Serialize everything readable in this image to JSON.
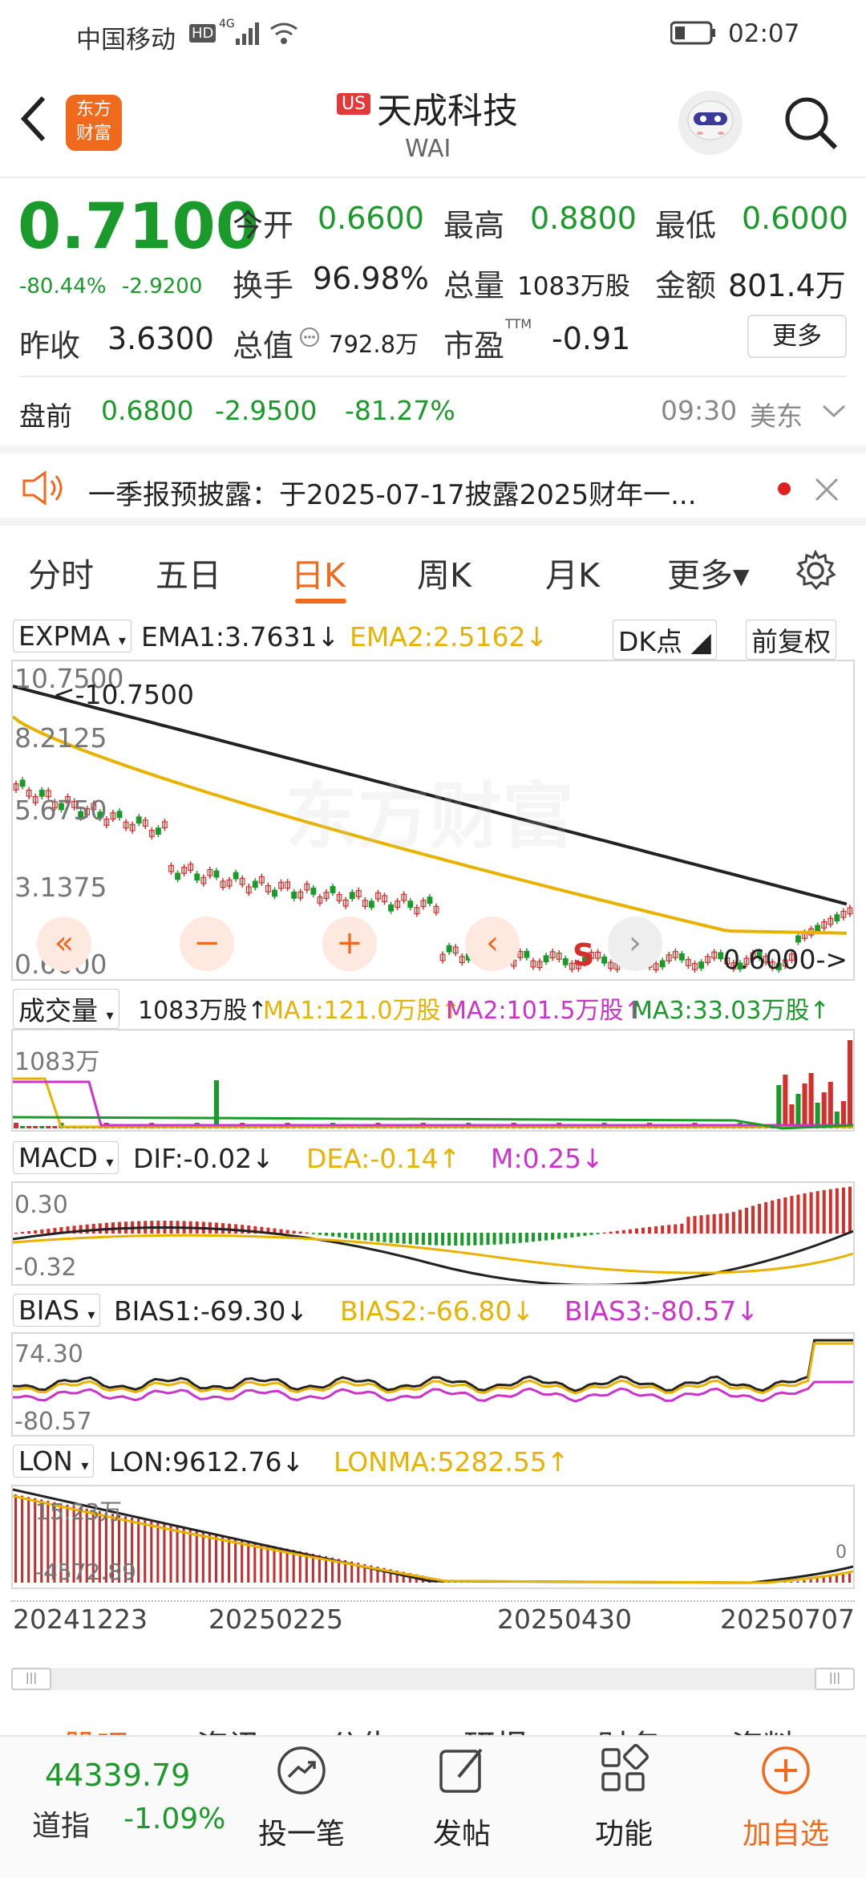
{
  "status_bar": {
    "carrier": "中国移动",
    "hd": "HD",
    "net": "4G",
    "time": "02:07"
  },
  "header": {
    "app_logo": "东方\n财富",
    "market_badge": "US",
    "stock_name": "天成科技",
    "ticker": "WAI"
  },
  "quote": {
    "price": "0.7100",
    "change_pct": "-80.44%",
    "change": "-2.9200",
    "open_label": "今开",
    "open": "0.6600",
    "high_label": "最高",
    "high": "0.8800",
    "low_label": "最低",
    "low": "0.6000",
    "turnover_label": "换手",
    "turnover": "96.98%",
    "volume_label": "总量",
    "volume": "1083万股",
    "amount_label": "金额",
    "amount": "801.4万",
    "prev_close_label": "昨收",
    "prev_close": "3.6300",
    "mktcap_label": "总值",
    "mktcap": "792.8万",
    "pe_label": "市盈",
    "pe_sup": "TTM",
    "pe": "-0.91",
    "more_label": "更多"
  },
  "premarket": {
    "label": "盘前",
    "price": "0.6800",
    "change": "-2.9500",
    "pct": "-81.27%",
    "time": "09:30",
    "zone": "美东"
  },
  "notice": {
    "text": "一季报预披露：于2025-07-17披露2025财年一..."
  },
  "tabs": [
    "分时",
    "五日",
    "日K",
    "周K",
    "月K",
    "更多▾"
  ],
  "active_tab": "日K",
  "ema_row": {
    "name": "EXPMA",
    "ema1": "EMA1:3.7631↓",
    "ema2": "EMA2:2.5162↓",
    "dk": "DK点",
    "adj": "前复权"
  },
  "kline": {
    "y_labels": [
      "10.7500",
      "8.2125",
      "5.6750",
      "3.1375",
      "0.6000"
    ],
    "max_note": "<-10.7500",
    "min_note": "0.6000->",
    "signal": "S",
    "watermark": "东方财富"
  },
  "volume_row": {
    "name": "成交量",
    "vol": "1083万股↑",
    "ma1": "MA1:121.0万股↑",
    "ma2": "MA2:101.5万股↑",
    "ma3": "MA3:33.03万股↑",
    "axis_top": "1083万"
  },
  "macd_row": {
    "name": "MACD",
    "dif": "DIF:-0.02↓",
    "dea": "DEA:-0.14↑",
    "m": "M:0.25↓",
    "axis_top": "0.30",
    "axis_bottom": "-0.32"
  },
  "bias_row": {
    "name": "BIAS",
    "b1": "BIAS1:-69.30↓",
    "b2": "BIAS2:-66.80↓",
    "b3": "BIAS3:-80.57↓",
    "axis_top": "74.30",
    "axis_bottom": "-80.57"
  },
  "lon_row": {
    "name": "LON",
    "lon": "LON:9612.76↓",
    "lonma": "LONMA:5282.55↑",
    "axis_top": "15.23万",
    "axis_bottom": "-4572.89",
    "axis_right": "0"
  },
  "dates": [
    "20241223",
    "20250225",
    "20250430",
    "20250707"
  ],
  "section_tabs": [
    "股吧",
    "资讯",
    "公告",
    "研报",
    "财务",
    "资料"
  ],
  "bottom_bar": {
    "index_value": "44339.79",
    "index_name": "道指",
    "index_pct": "-1.09%",
    "items": [
      "投一笔",
      "发帖",
      "功能",
      "加自选"
    ]
  },
  "colors": {
    "up": "#d4302b",
    "down": "#1a9a2a",
    "accent": "#f06a1d",
    "ema1": "#222222",
    "ema2": "#e8b200",
    "ma3": "#cc33cc"
  }
}
